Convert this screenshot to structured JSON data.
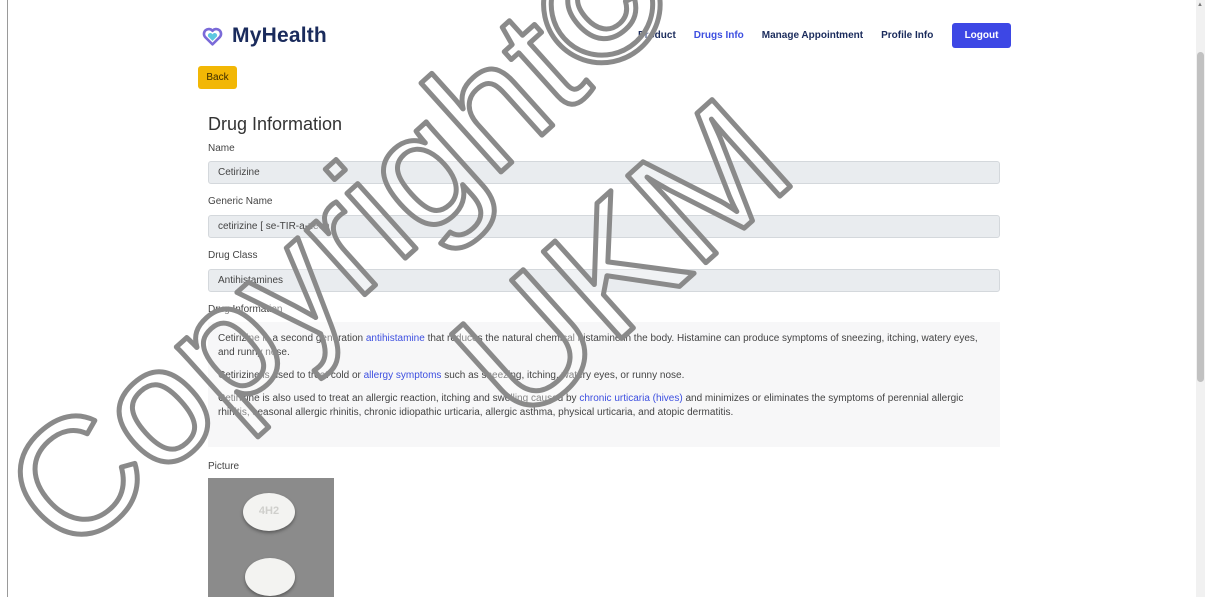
{
  "brand": {
    "name": "MyHealth"
  },
  "nav": {
    "items": [
      {
        "label": "Product",
        "active": false
      },
      {
        "label": "Drugs Info",
        "active": true
      },
      {
        "label": "Manage Appointment",
        "active": false
      },
      {
        "label": "Profile Info",
        "active": false
      }
    ],
    "logout_label": "Logout"
  },
  "back_label": "Back",
  "page_title": "Drug Information",
  "fields": {
    "name": {
      "label": "Name",
      "value": "Cetirizine"
    },
    "generic_name": {
      "label": "Generic Name",
      "value": "cetirizine [ se-TIR-a-zeen ]"
    },
    "drug_class": {
      "label": "Drug Class",
      "value": "Antihistamines"
    }
  },
  "drug_info": {
    "label": "Drug Information",
    "p1": {
      "pre": "Cetirizine is a second generation ",
      "link": "antihistamine",
      "post": " that reduces the natural chemical histamine in the body. Histamine can produce symptoms of sneezing, itching, watery eyes, and runny nose."
    },
    "p2": {
      "pre": "Cetirizine is used to treat cold or ",
      "link": "allergy symptoms",
      "post": " such as sneezing, itching, watery eyes, or runny nose."
    },
    "p3": {
      "pre": "Cetirizine is also used to treat an allergic reaction, itching and swelling caused by ",
      "link": "chronic urticaria (hives)",
      "post": " and minimizes or eliminates the symptoms of perennial allergic rhinitis, seasonal allergic rhinitis, chronic idiopathic urticaria, allergic asthma, physical urticaria, and atopic dermatitis."
    }
  },
  "picture": {
    "label": "Picture",
    "pill_imprint": "4H2"
  },
  "watermark": {
    "line1": "Copyright©",
    "line2": "UKM"
  },
  "colors": {
    "primary": "#3d47e5",
    "back": "#f2b705",
    "link": "#3d4fe0",
    "navy": "#1a2b5c"
  }
}
